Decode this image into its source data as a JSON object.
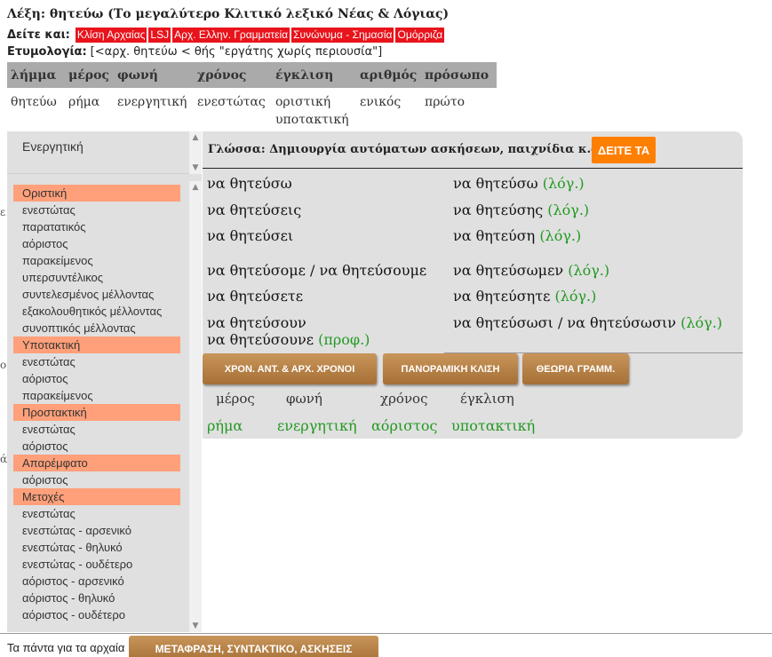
{
  "header": {
    "lexi": "Λέξη: θητεύω (Το μεγαλύτερο Κλιτικό λεξικό Νέας & Λόγιας)",
    "see_also_label": "Δείτε και:",
    "see_also": [
      "Κλίση Αρχαίας",
      "LSJ",
      "Αρχ. Ελλην. Γραμματεία",
      "Συνώνυμα - Σημασία",
      "Ομόρριζα"
    ],
    "etym_label": "Ετυμολογία:",
    "etym_text": "[<αρχ. θητεύω < θής \"εργάτης χωρίς περιουσία\"]"
  },
  "morph": {
    "headers": [
      "λήμμα",
      "μέρος",
      "φωνή",
      "χρόνος",
      "έγκλιση",
      "αριθμός",
      "πρόσωπο"
    ],
    "values": [
      "θητεύω",
      "ρήμα",
      "ενεργητική",
      "ενεστώτας",
      "οριστική",
      "ενικός",
      "πρώτο"
    ],
    "extra": "υποτακτική"
  },
  "sidebar": {
    "voice": "Ενεργητική",
    "items": [
      {
        "label": "Οριστική",
        "head": true
      },
      {
        "label": "ενεστώτας"
      },
      {
        "label": "παρατατικός"
      },
      {
        "label": "αόριστος"
      },
      {
        "label": "παρακείμενος"
      },
      {
        "label": "υπερσυντέλικος"
      },
      {
        "label": "συντελεσμένος μέλλοντας"
      },
      {
        "label": "εξακολουθητικός μέλλοντας"
      },
      {
        "label": "συνοπτικός μέλλοντας"
      },
      {
        "label": "Υποτακτική",
        "head": true
      },
      {
        "label": "ενεστώτας"
      },
      {
        "label": "αόριστος"
      },
      {
        "label": "παρακείμενος"
      },
      {
        "label": "Προστακτική",
        "head": true
      },
      {
        "label": "ενεστώτας"
      },
      {
        "label": "αόριστος"
      },
      {
        "label": "Απαρέμφατο",
        "head": true
      },
      {
        "label": "αόριστος"
      },
      {
        "label": "Μετοχές",
        "head": true
      },
      {
        "label": "ενεστώτας"
      },
      {
        "label": "ενεστώτας - αρσενικό"
      },
      {
        "label": "ενεστώτας - θηλυκό"
      },
      {
        "label": "ενεστώτας - ουδέτερο"
      },
      {
        "label": "αόριστος - αρσενικό"
      },
      {
        "label": "αόριστος - θηλυκό"
      },
      {
        "label": "αόριστος - ουδέτερο"
      }
    ]
  },
  "main": {
    "glossa": "Γλώσσα: Δημιουργία αυτόματων ασκήσεων, παιχνίδια κ.α.:",
    "see_btn": "ΔΕΙΤΕ ΤΑ",
    "left": [
      "να θητεύσω",
      "να θητεύσεις",
      "να θητεύσει",
      "να θητεύσομε / να θητεύσουμε",
      "να θητεύσετε",
      "να θητεύσουν"
    ],
    "left_extra": "να θητεύσουνε",
    "left_extra_tag": "(προφ.)",
    "right": [
      "να θητεύσω",
      "να θητεύσης",
      "να θητεύση",
      "να θητεύσωμεν",
      "να θητεύσητε",
      "να θητεύσωσι / να θητεύσωσιν"
    ],
    "right_tag": "(λόγ.)",
    "btn1": "ΧΡΟΝ. ΑΝΤ. & ΑΡΧ. ΧΡΟΝΟΙ",
    "btn2": "ΠΑΝΟΡΑΜΙΚΗ ΚΛΙΣΗ",
    "btn3": "ΘΕΩΡΙΑ ΓΡΑΜΜ.",
    "info_headers": [
      "μέρος",
      "φωνή",
      "χρόνος",
      "έγκλιση"
    ],
    "info_values": [
      "ρήμα",
      "ενεργητική",
      "αόριστος",
      "υποτακτική"
    ]
  },
  "footer": {
    "text": "Τα πάντα για τα αρχαία",
    "btn": "ΜΕΤΑΦΡΑΣΗ, ΣΥΝΤΑΚΤΙΚΟ, ΑΣΚΗΣΕΙΣ"
  },
  "edge_glyphs": [
    "ε",
    "ο",
    "ά"
  ],
  "colors": {
    "tag_red": "#e8131b",
    "head_salmon": "#ffa07a",
    "accent_orange": "#ff7f00",
    "green": "#229922",
    "brown": "#a67037"
  }
}
